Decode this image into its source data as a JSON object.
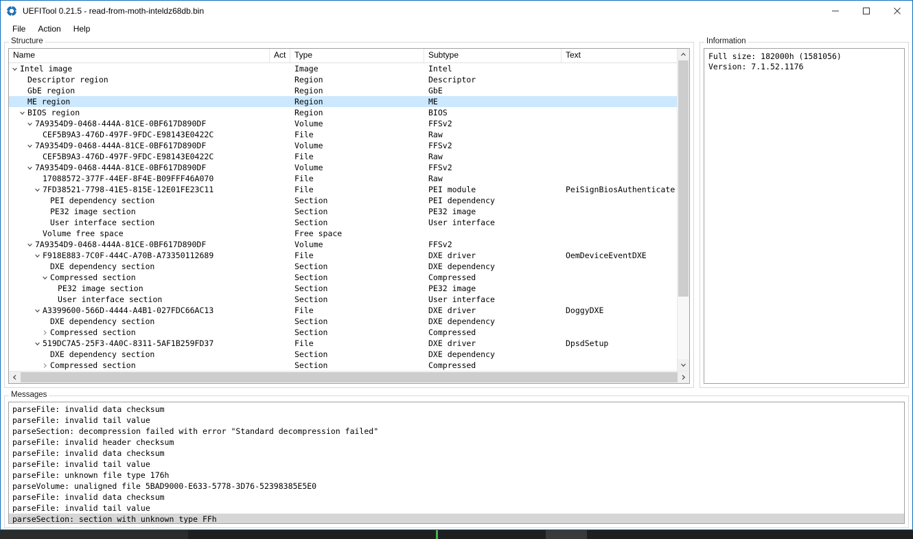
{
  "window": {
    "title": "UEFITool 0.21.5 - read-from-moth-inteldz68db.bin",
    "icon": "gear-icon",
    "minimize_label": "─",
    "maximize_label": "□",
    "close_label": "✕"
  },
  "menu": {
    "items": [
      {
        "label": "File"
      },
      {
        "label": "Action"
      },
      {
        "label": "Help"
      }
    ]
  },
  "structure": {
    "group_label": "Structure",
    "columns": [
      "Name",
      "Act",
      "Type",
      "Subtype",
      "Text"
    ],
    "rows": [
      {
        "indent": 0,
        "state": "expanded",
        "name": "Intel image",
        "act": "",
        "type": "Image",
        "subtype": "Intel",
        "text": "",
        "selected": false
      },
      {
        "indent": 1,
        "state": "leaf",
        "name": "Descriptor region",
        "act": "",
        "type": "Region",
        "subtype": "Descriptor",
        "text": "",
        "selected": false
      },
      {
        "indent": 1,
        "state": "leaf",
        "name": "GbE region",
        "act": "",
        "type": "Region",
        "subtype": "GbE",
        "text": "",
        "selected": false
      },
      {
        "indent": 1,
        "state": "leaf",
        "name": "ME region",
        "act": "",
        "type": "Region",
        "subtype": "ME",
        "text": "",
        "selected": true
      },
      {
        "indent": 1,
        "state": "expanded",
        "name": "BIOS region",
        "act": "",
        "type": "Region",
        "subtype": "BIOS",
        "text": "",
        "selected": false
      },
      {
        "indent": 2,
        "state": "expanded",
        "name": "7A9354D9-0468-444A-81CE-0BF617D890DF",
        "act": "",
        "type": "Volume",
        "subtype": "FFSv2",
        "text": "",
        "selected": false
      },
      {
        "indent": 3,
        "state": "leaf",
        "name": "CEF5B9A3-476D-497F-9FDC-E98143E0422C",
        "act": "",
        "type": "File",
        "subtype": "Raw",
        "text": "",
        "selected": false
      },
      {
        "indent": 2,
        "state": "expanded",
        "name": "7A9354D9-0468-444A-81CE-0BF617D890DF",
        "act": "",
        "type": "Volume",
        "subtype": "FFSv2",
        "text": "",
        "selected": false
      },
      {
        "indent": 3,
        "state": "leaf",
        "name": "CEF5B9A3-476D-497F-9FDC-E98143E0422C",
        "act": "",
        "type": "File",
        "subtype": "Raw",
        "text": "",
        "selected": false
      },
      {
        "indent": 2,
        "state": "expanded",
        "name": "7A9354D9-0468-444A-81CE-0BF617D890DF",
        "act": "",
        "type": "Volume",
        "subtype": "FFSv2",
        "text": "",
        "selected": false
      },
      {
        "indent": 3,
        "state": "leaf",
        "name": "17088572-377F-44EF-8F4E-B09FFF46A070",
        "act": "",
        "type": "File",
        "subtype": "Raw",
        "text": "",
        "selected": false
      },
      {
        "indent": 3,
        "state": "expanded",
        "name": "7FD38521-7798-41E5-815E-12E01FE23C11",
        "act": "",
        "type": "File",
        "subtype": "PEI module",
        "text": "PeiSignBiosAuthenticate",
        "selected": false
      },
      {
        "indent": 4,
        "state": "leaf",
        "name": "PEI dependency section",
        "act": "",
        "type": "Section",
        "subtype": "PEI dependency",
        "text": "",
        "selected": false
      },
      {
        "indent": 4,
        "state": "leaf",
        "name": "PE32 image section",
        "act": "",
        "type": "Section",
        "subtype": "PE32 image",
        "text": "",
        "selected": false
      },
      {
        "indent": 4,
        "state": "leaf",
        "name": "User interface section",
        "act": "",
        "type": "Section",
        "subtype": "User interface",
        "text": "",
        "selected": false
      },
      {
        "indent": 3,
        "state": "leaf",
        "name": "Volume free space",
        "act": "",
        "type": "Free space",
        "subtype": "",
        "text": "",
        "selected": false
      },
      {
        "indent": 2,
        "state": "expanded",
        "name": "7A9354D9-0468-444A-81CE-0BF617D890DF",
        "act": "",
        "type": "Volume",
        "subtype": "FFSv2",
        "text": "",
        "selected": false
      },
      {
        "indent": 3,
        "state": "expanded",
        "name": "F918E883-7C0F-444C-A70B-A73350112689",
        "act": "",
        "type": "File",
        "subtype": "DXE driver",
        "text": "OemDeviceEventDXE",
        "selected": false
      },
      {
        "indent": 4,
        "state": "leaf",
        "name": "DXE dependency section",
        "act": "",
        "type": "Section",
        "subtype": "DXE dependency",
        "text": "",
        "selected": false
      },
      {
        "indent": 4,
        "state": "expanded",
        "name": "Compressed section",
        "act": "",
        "type": "Section",
        "subtype": "Compressed",
        "text": "",
        "selected": false
      },
      {
        "indent": 5,
        "state": "leaf",
        "name": "PE32 image section",
        "act": "",
        "type": "Section",
        "subtype": "PE32 image",
        "text": "",
        "selected": false
      },
      {
        "indent": 5,
        "state": "leaf",
        "name": "User interface section",
        "act": "",
        "type": "Section",
        "subtype": "User interface",
        "text": "",
        "selected": false
      },
      {
        "indent": 3,
        "state": "expanded",
        "name": "A3399600-566D-4444-A4B1-027FDC66AC13",
        "act": "",
        "type": "File",
        "subtype": "DXE driver",
        "text": "DoggyDXE",
        "selected": false
      },
      {
        "indent": 4,
        "state": "leaf",
        "name": "DXE dependency section",
        "act": "",
        "type": "Section",
        "subtype": "DXE dependency",
        "text": "",
        "selected": false
      },
      {
        "indent": 4,
        "state": "collapsed",
        "name": "Compressed section",
        "act": "",
        "type": "Section",
        "subtype": "Compressed",
        "text": "",
        "selected": false
      },
      {
        "indent": 3,
        "state": "expanded",
        "name": "519DC7A5-25F3-4A0C-8311-5AF1B259FD37",
        "act": "",
        "type": "File",
        "subtype": "DXE driver",
        "text": "DpsdSetup",
        "selected": false
      },
      {
        "indent": 4,
        "state": "leaf",
        "name": "DXE dependency section",
        "act": "",
        "type": "Section",
        "subtype": "DXE dependency",
        "text": "",
        "selected": false
      },
      {
        "indent": 4,
        "state": "collapsed",
        "name": "Compressed section",
        "act": "",
        "type": "Section",
        "subtype": "Compressed",
        "text": "",
        "selected": false
      }
    ]
  },
  "information": {
    "group_label": "Information",
    "lines": [
      "Full size: 182000h (1581056)",
      "Version: 7.1.52.1176"
    ]
  },
  "messages": {
    "group_label": "Messages",
    "rows": [
      {
        "text": "parseFile: invalid data checksum",
        "highlight": false
      },
      {
        "text": "parseFile: invalid tail value",
        "highlight": false
      },
      {
        "text": "parseSection: decompression failed with error \"Standard decompression failed\"",
        "highlight": false
      },
      {
        "text": "parseFile: invalid header checksum",
        "highlight": false
      },
      {
        "text": "parseFile: invalid data checksum",
        "highlight": false
      },
      {
        "text": "parseFile: invalid tail value",
        "highlight": false
      },
      {
        "text": "parseFile: unknown file type 176h",
        "highlight": false
      },
      {
        "text": "parseVolume: unaligned file 5BAD9000-E633-5778-3D76-52398385E5E0",
        "highlight": false
      },
      {
        "text": "parseFile: invalid data checksum",
        "highlight": false
      },
      {
        "text": "parseFile: invalid tail value",
        "highlight": false
      },
      {
        "text": "parseSection: section with unknown type FFh",
        "highlight": true
      }
    ]
  },
  "colors": {
    "selection": "#cce8ff",
    "window_border": "#0a6ebd",
    "scrollbar_thumb": "#cdcdcd",
    "message_highlight": "#d6d6d6",
    "taskbar": "#1f1f1f"
  }
}
